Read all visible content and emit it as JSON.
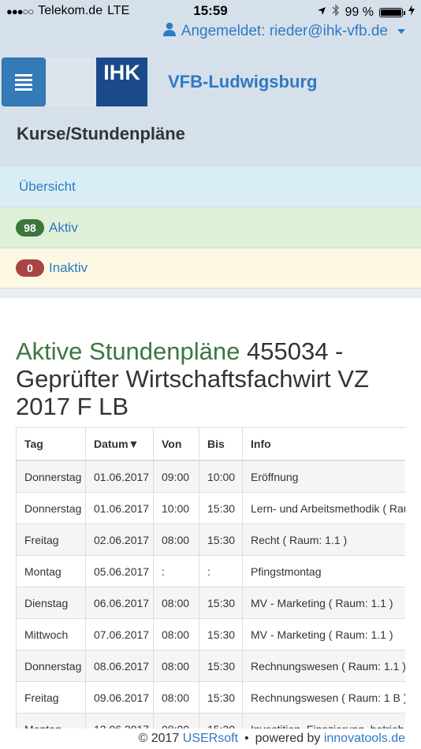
{
  "status_bar": {
    "carrier": "Telekom.de",
    "network": "LTE",
    "time": "15:59",
    "battery": "99 %",
    "battery_level": 0.99
  },
  "header": {
    "user_label": "Angemeldet: rieder@ihk-vfb.de",
    "logo_text": "IHK",
    "org_name": "VFB-Ludwigsburg",
    "page_title": "Kurse/Stundenpläne"
  },
  "nav": {
    "overview": "Übersicht",
    "active_count": "98",
    "active_label": "Aktiv",
    "inactive_count": "0",
    "inactive_label": "Inaktiv"
  },
  "content": {
    "title_highlight": "Aktive Stundenpläne",
    "title_rest": "455034 - Geprüfter Wirtschaftsfachwirt VZ 2017 F LB"
  },
  "table": {
    "headers": [
      "Tag",
      "Datum▼",
      "Von",
      "Bis",
      "Info"
    ],
    "rows": [
      [
        "Donnerstag",
        "01.06.2017",
        "09:00",
        "10:00",
        "Eröffnung"
      ],
      [
        "Donnerstag",
        "01.06.2017",
        "10:00",
        "15:30",
        "Lern- und Arbeitsmethodik ( Raum"
      ],
      [
        "Freitag",
        "02.06.2017",
        "08:00",
        "15:30",
        "Recht ( Raum: 1.1 )"
      ],
      [
        "Montag",
        "05.06.2017",
        ":",
        ":",
        "Pfingstmontag"
      ],
      [
        "Dienstag",
        "06.06.2017",
        "08:00",
        "15:30",
        "MV - Marketing ( Raum: 1.1 )"
      ],
      [
        "Mittwoch",
        "07.06.2017",
        "08:00",
        "15:30",
        "MV - Marketing ( Raum: 1.1 )"
      ],
      [
        "Donnerstag",
        "08.06.2017",
        "08:00",
        "15:30",
        "Rechnungswesen ( Raum: 1.1 )"
      ],
      [
        "Freitag",
        "09.06.2017",
        "08:00",
        "15:30",
        "Rechnungswesen ( Raum: 1 B )"
      ],
      [
        "Montag",
        "12.06.2017",
        "08:00",
        "15:30",
        "Investition, Finazierung, betrieb. R"
      ]
    ]
  },
  "footer": {
    "copyright": "© 2017",
    "company": "USERsoft",
    "separator": "•",
    "powered_label": "powered by",
    "powered_link": "innovatools.de"
  },
  "colors": {
    "header_bg": "#d6e0ea",
    "link_blue": "#2e7ac4",
    "green": "#3c763d",
    "red": "#a94442",
    "logo_blue": "#1a4a8a"
  }
}
